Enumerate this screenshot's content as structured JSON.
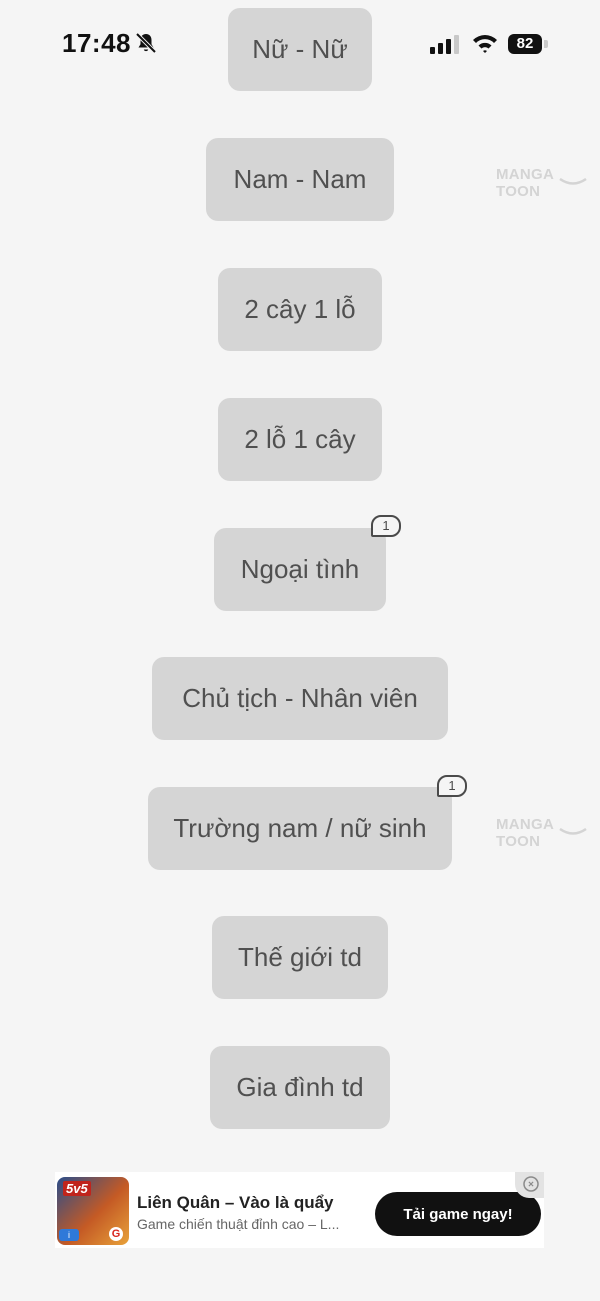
{
  "status_bar": {
    "time": "17:48",
    "battery": "82",
    "icons": [
      "bell-slash-icon",
      "signal-icon",
      "wifi-icon",
      "battery-icon"
    ]
  },
  "watermark": "MANGA TOON",
  "genres": [
    {
      "label": "Nữ - Nữ",
      "badge": null
    },
    {
      "label": "Nam - Nam",
      "badge": null
    },
    {
      "label": "2 cây 1 lỗ",
      "badge": null
    },
    {
      "label": "2 lỗ 1 cây",
      "badge": null
    },
    {
      "label": "Ngoại tình",
      "badge": "1"
    },
    {
      "label": "Chủ tịch - Nhân viên",
      "badge": null
    },
    {
      "label": "Trường nam / nữ sinh",
      "badge": "1"
    },
    {
      "label": "Thế giới td",
      "badge": null
    },
    {
      "label": "Gia đình td",
      "badge": null
    }
  ],
  "ad": {
    "icon_text": "5v5",
    "title": "Liên Quân – Vào là quẩy",
    "subtitle": "Game chiến thuật đỉnh cao – L...",
    "cta": "Tải game ngay!"
  },
  "colors": {
    "background": "#f5f5f5",
    "button_bg": "#d5d5d5",
    "button_text": "#505050",
    "cta_bg": "#111111"
  }
}
